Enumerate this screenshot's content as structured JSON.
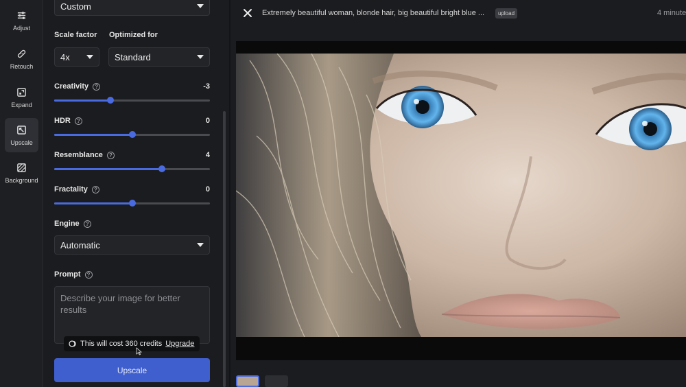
{
  "rail": {
    "items": [
      {
        "label": "Adjust",
        "icon": "sliders-icon"
      },
      {
        "label": "Retouch",
        "icon": "bandage-icon"
      },
      {
        "label": "Expand",
        "icon": "expand-icon"
      },
      {
        "label": "Upscale",
        "icon": "upscale-icon",
        "active": true
      },
      {
        "label": "Background",
        "icon": "background-icon"
      }
    ]
  },
  "panel": {
    "mode_value": "Custom",
    "scale_factor_label": "Scale factor",
    "scale_factor_value": "4x",
    "optimized_for_label": "Optimized for",
    "optimized_for_value": "Standard",
    "sliders": [
      {
        "label": "Creativity",
        "value": "-3",
        "fraction": 0.36
      },
      {
        "label": "HDR",
        "value": "0",
        "fraction": 0.5
      },
      {
        "label": "Resemblance",
        "value": "4",
        "fraction": 0.69
      },
      {
        "label": "Fractality",
        "value": "0",
        "fraction": 0.5
      }
    ],
    "engine_label": "Engine",
    "engine_value": "Automatic",
    "prompt_label": "Prompt",
    "prompt_placeholder": "Describe your image for better results",
    "cost_text": "This will cost 360 credits",
    "upgrade_link": "Upgrade",
    "upscale_button": "Upscale"
  },
  "preview": {
    "title": "Extremely beautiful woman, blonde hair, big beautiful bright blue ...",
    "badge": "upload",
    "time": "4 minute"
  },
  "colors": {
    "accent": "#4a6be0",
    "button": "#3f5fcf",
    "eye": "#5fb0ea"
  }
}
